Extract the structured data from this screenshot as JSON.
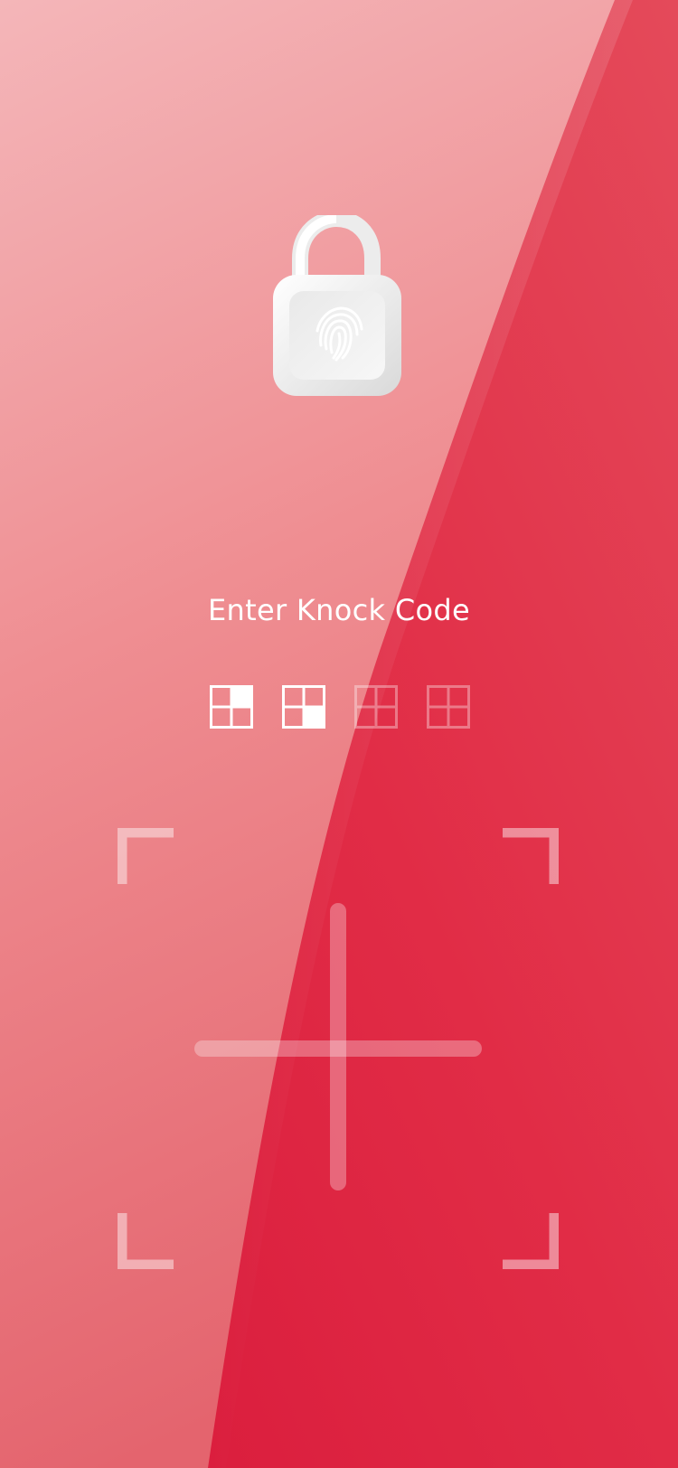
{
  "screen": {
    "title": "Enter Knock Code"
  },
  "lock_icon": {
    "name": "unlocked-padlock-fingerprint-icon"
  },
  "progress": {
    "entered": 2,
    "total": 4,
    "dots": [
      {
        "filled_quadrant": "top-right",
        "entered": true
      },
      {
        "filled_quadrant": "bottom-right",
        "entered": true
      },
      {
        "filled_quadrant": null,
        "entered": false
      },
      {
        "filled_quadrant": null,
        "entered": false
      }
    ]
  },
  "knock_pad": {
    "quadrants": [
      "top-left",
      "top-right",
      "bottom-left",
      "bottom-right"
    ]
  },
  "colors": {
    "accent_red": "#e23a52",
    "light_pink": "#f2a3a8",
    "white": "#ffffff"
  }
}
